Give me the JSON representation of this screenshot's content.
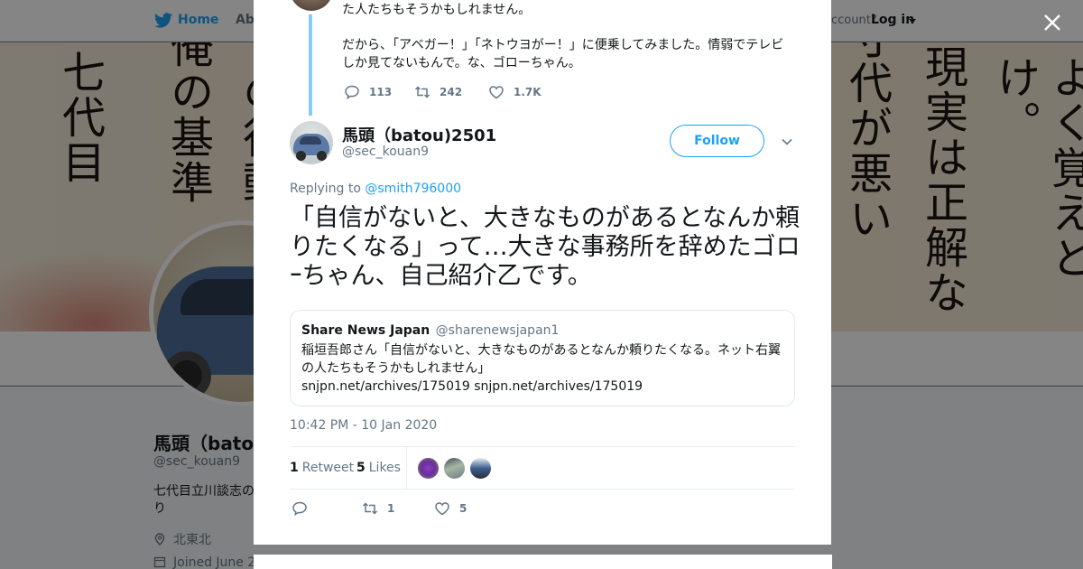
{
  "nav": {
    "home": "Home",
    "about": "Abo",
    "account_prompt": "ccount?",
    "login": "Log in"
  },
  "banner": {
    "calligraphy_columns": [
      "七代目",
      "俺の基準",
      "ての行動",
      "寸代が悪い",
      "現実は正解な",
      "よく覚えとけ。"
    ]
  },
  "profile": {
    "name": "馬頭（batou",
    "handle": "@sec_kouan9",
    "bio": "七代目立川談志の\nり",
    "location": "北東北",
    "joined": "Joined June 2"
  },
  "previous_tweet": {
    "text_line1": "た人たちもそうかもしれません。",
    "text_para2": "だから、「アベガー！」「ネトウヨがー！」に便乗してみました。情弱でテレビしか見てないもんで。な、ゴローちゃん。",
    "replies": "113",
    "retweets": "242",
    "likes": "1.7K"
  },
  "tweet": {
    "author_name": "馬頭（batou)2501",
    "author_handle": "@sec_kouan9",
    "follow_label": "Follow",
    "replying_prefix": "Replying to",
    "replying_to": "@smith796000",
    "text": "「自信がないと、大きなものがあるとなんか頼りたくなる」って…大きな事務所を辞めたゴロｰちゃん、自己紹介乙です。",
    "timestamp": "10:42 PM - 10 Jan 2020",
    "retweet_count": "1",
    "retweet_label": "Retweet",
    "like_count": "5",
    "like_label": "Likes",
    "action_retweets": "1",
    "action_likes": "5"
  },
  "quoted": {
    "name": "Share News Japan",
    "handle": "@sharenewsjapan1",
    "text": "稲垣吾郎さん「自信がないと、大きなものがあるとなんか頼りたくなる。ネット右翼の人たちもそうかもしれません」",
    "links": "snjpn.net/archives/175019 snjpn.net/archives/175019"
  },
  "icons": {
    "brand": "twitter-bird-icon",
    "reply": "reply-icon",
    "retweet": "retweet-icon",
    "like": "heart-icon",
    "close": "close-icon",
    "caret": "chevron-down-icon",
    "location": "location-pin-icon",
    "calendar": "calendar-icon"
  },
  "colors": {
    "accent": "#1da1f2",
    "muted_text": "#657786",
    "primary_text": "#14171a",
    "border": "#e1e8ed"
  }
}
